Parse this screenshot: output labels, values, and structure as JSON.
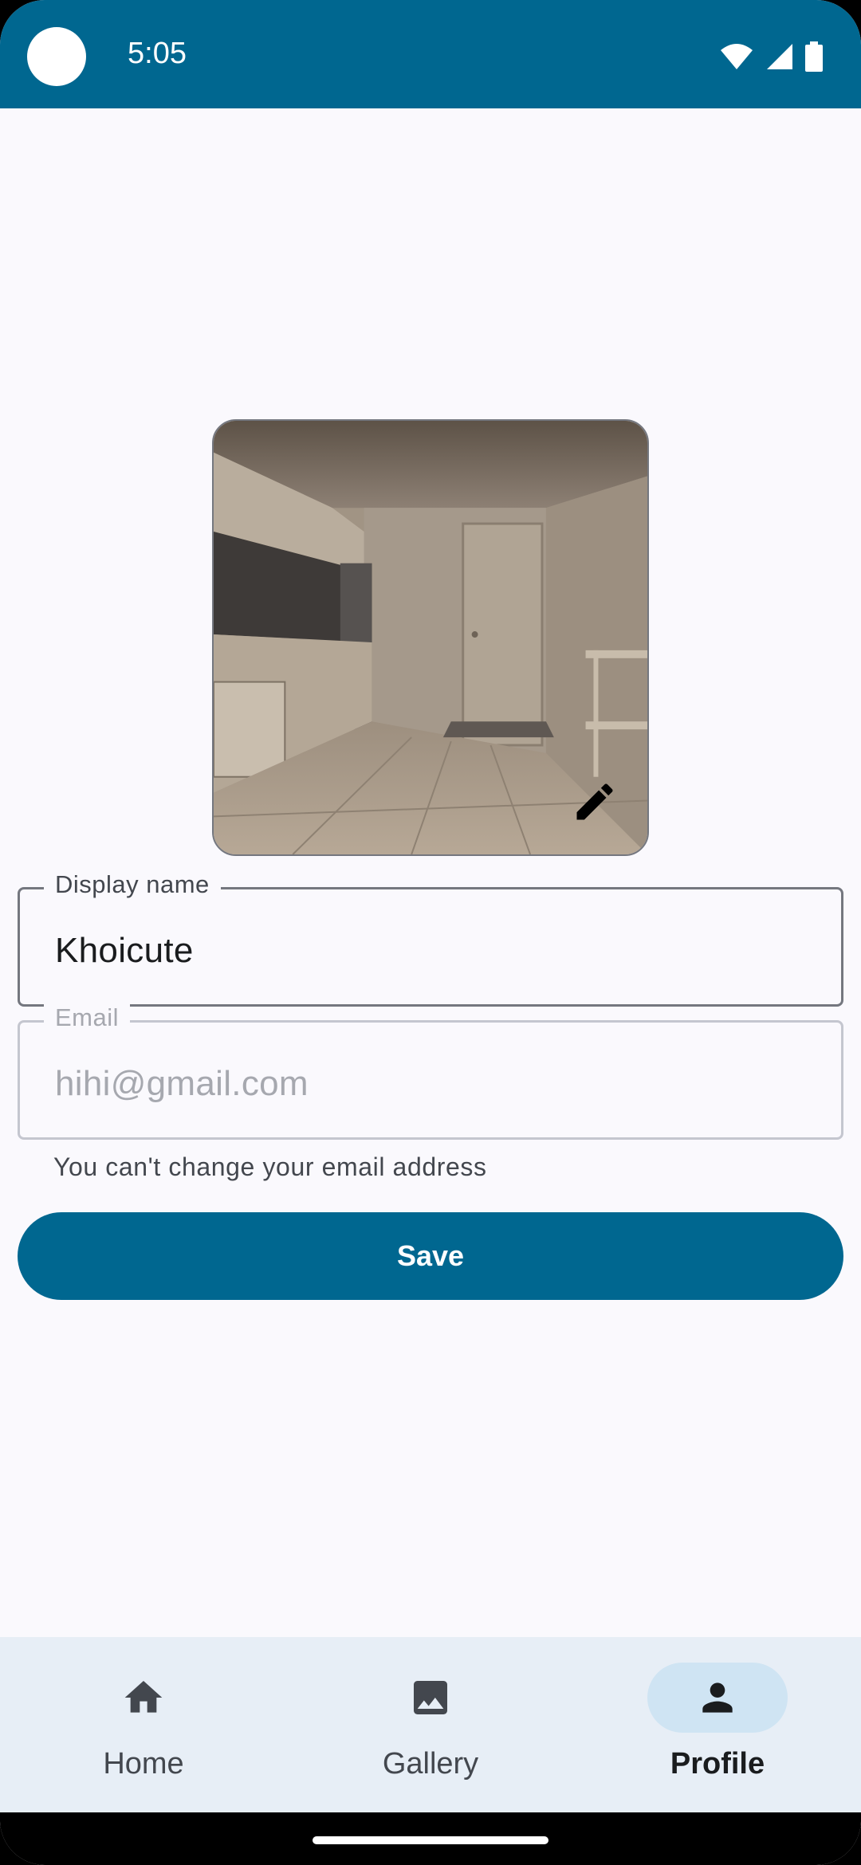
{
  "status_bar": {
    "time": "5:05",
    "icons": [
      "wifi-icon",
      "cell-signal-icon",
      "battery-icon"
    ]
  },
  "profile": {
    "avatar_image": "kitchen-interior-photo",
    "edit_icon": "pencil-icon"
  },
  "form": {
    "display_name": {
      "label": "Display name",
      "value": "Khoicute"
    },
    "email": {
      "label": "Email",
      "value": "hihi@gmail.com",
      "helper": "You can't change your email address"
    },
    "save_label": "Save"
  },
  "nav": {
    "items": [
      {
        "label": "Home",
        "icon": "home-icon",
        "selected": false
      },
      {
        "label": "Gallery",
        "icon": "image-icon",
        "selected": false
      },
      {
        "label": "Profile",
        "icon": "person-icon",
        "selected": true
      }
    ]
  },
  "colors": {
    "primary": "#006790",
    "background": "#FAF9FD",
    "nav_background": "#E7EEF6",
    "nav_selected": "#CFE4F3"
  }
}
